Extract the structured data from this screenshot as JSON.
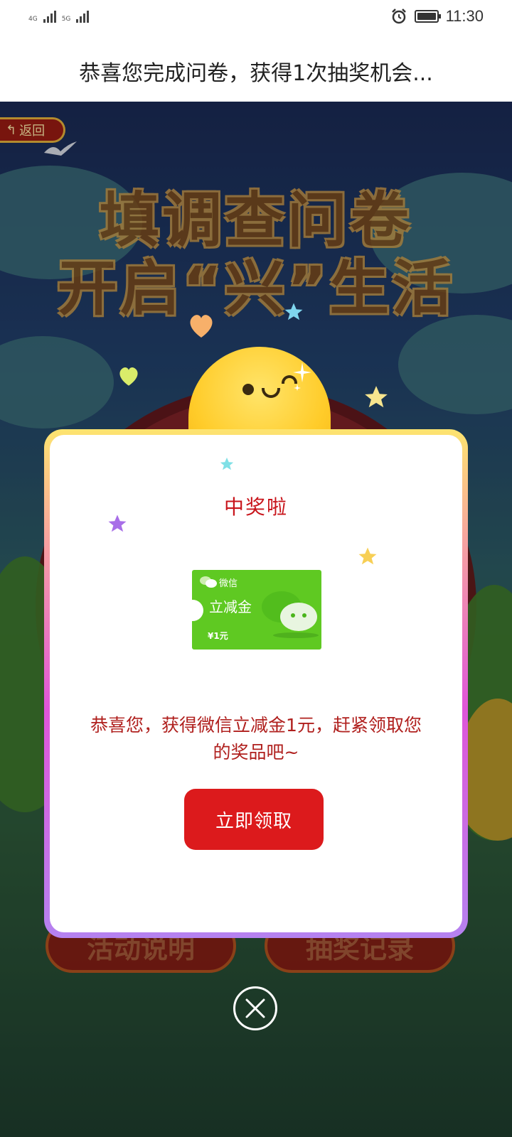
{
  "status_bar": {
    "sim1": "4G",
    "sim2": "5G",
    "time": "11:30",
    "alarm_icon": "alarm-icon",
    "battery_icon": "battery-icon"
  },
  "title_bar": {
    "title": "恭喜您完成问卷，获得1次抽奖机会..."
  },
  "background": {
    "back_label": "返回",
    "headline_line1": "填调查问卷",
    "headline_line2": "开启“兴”生活",
    "rules_button": "活动说明",
    "records_button": "抽奖记录"
  },
  "modal": {
    "title": "中奖啦",
    "coupon": {
      "brand": "微信",
      "title": "立减金",
      "value": "¥1元"
    },
    "description": "恭喜您，获得微信立减金1元，赶紧领取您的奖品吧~",
    "claim_button": "立即领取"
  },
  "colors": {
    "accent_red": "#dc1a1c",
    "text_red": "#b0201e",
    "coupon_green": "#5fc922"
  }
}
